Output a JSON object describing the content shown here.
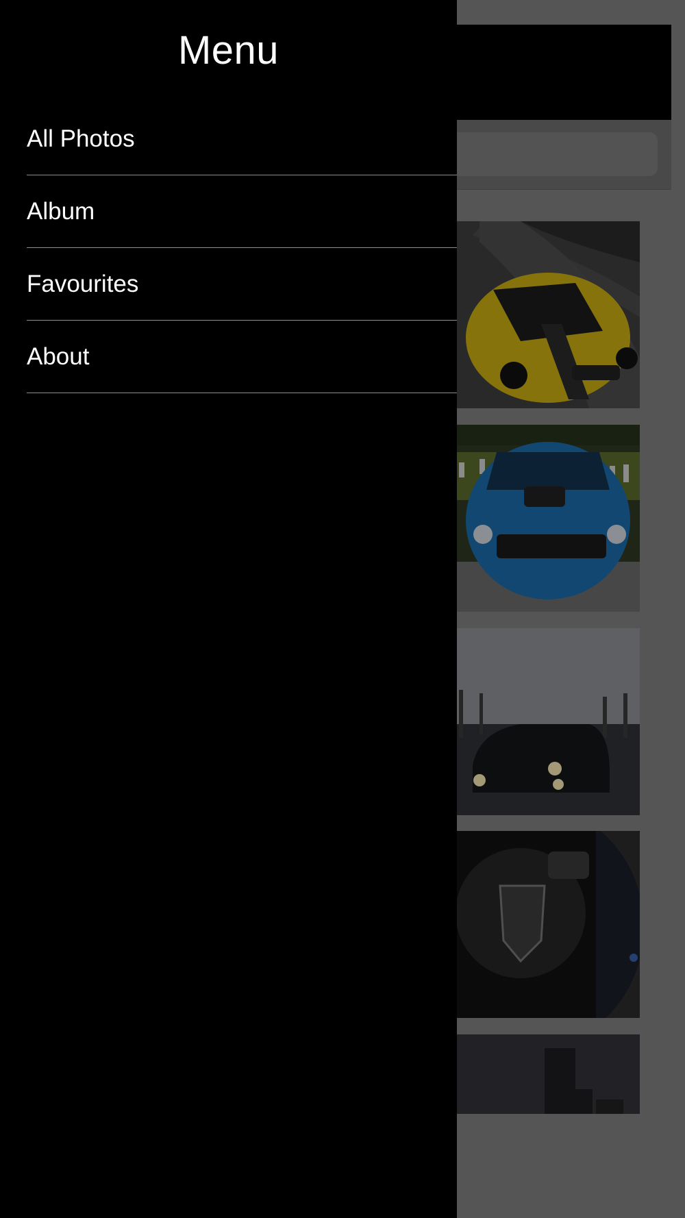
{
  "drawer": {
    "title": "Menu",
    "items": [
      {
        "label": "All Photos"
      },
      {
        "label": "Album"
      },
      {
        "label": "Favourites"
      },
      {
        "label": "About"
      }
    ]
  },
  "background_app": {
    "photos": [
      {
        "subject": "yellow-car-photo"
      },
      {
        "subject": "blue-car-photo"
      },
      {
        "subject": "black-car-photo"
      },
      {
        "subject": "steering-wheel-photo"
      },
      {
        "subject": "city-building-photo"
      }
    ]
  },
  "colors": {
    "drawer_background": "#000000",
    "overlay_gray": "#7f7f7f",
    "separator": "#8e8e8e",
    "text": "#ffffff"
  }
}
